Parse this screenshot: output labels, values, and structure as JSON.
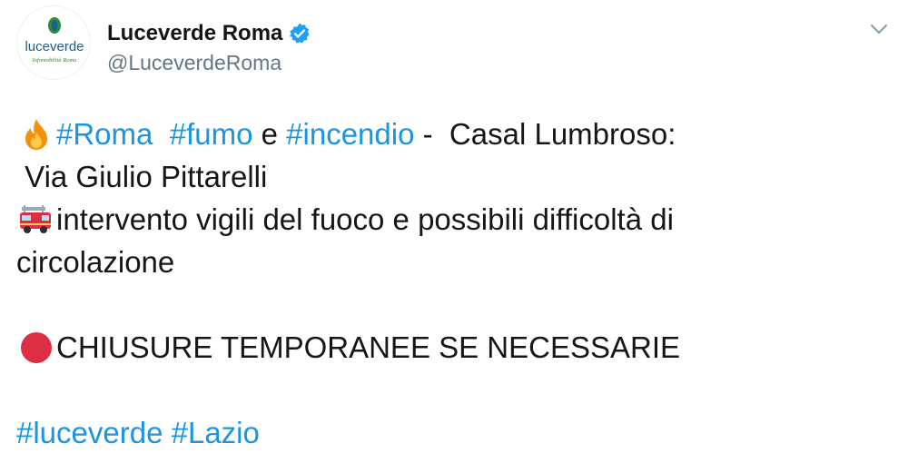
{
  "author": {
    "display_name": "Luceverde Roma",
    "handle": "@LuceverdeRoma",
    "avatar_text": "luceverde",
    "avatar_subtext": "Infomobilità Roma",
    "verified": true
  },
  "tweet": {
    "line1": {
      "emoji": "fire-emoji",
      "tag1": "#Roma",
      "sep1": "  ",
      "tag2": "#fumo",
      "text1": " e ",
      "tag3": "#incendio",
      "text2": " -  Casal Lumbroso:"
    },
    "line2": " Via Giulio Pittarelli",
    "line3": {
      "emoji": "fire-engine-emoji",
      "text": "intervento vigili del fuoco e possibili difficoltà di"
    },
    "line4": "circolazione",
    "line5": {
      "emoji": "red-circle-emoji",
      "text": "CHIUSURE TEMPORANEE SE NECESSARIE"
    },
    "line6": {
      "tag1": "#luceverde",
      "sep": " ",
      "tag2": "#Lazio"
    }
  },
  "colors": {
    "hashtag": "#1b95e0",
    "text": "#14171a",
    "handle": "#657786",
    "verified": "#1da1f2"
  }
}
